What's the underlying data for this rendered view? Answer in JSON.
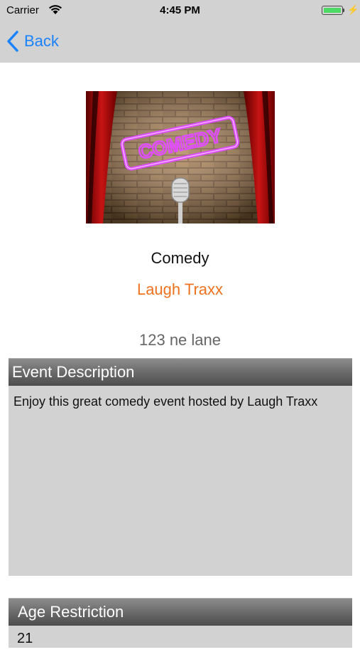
{
  "status_bar": {
    "carrier": "Carrier",
    "time": "4:45 PM",
    "battery_level": 1.0,
    "battery_color": "#4cd964",
    "icons": [
      "wifi-icon",
      "battery-icon",
      "charging-bolt-icon"
    ]
  },
  "nav": {
    "back_label": "Back",
    "accent_color": "#1a82fb"
  },
  "event": {
    "image_sign_text": "COMEDY",
    "title": "Comedy",
    "host": "Laugh Traxx",
    "host_color": "#ee7220",
    "address": "123 ne lane"
  },
  "description": {
    "header": "Event Description",
    "text": "Enjoy this great comedy event hosted by Laugh Traxx"
  },
  "age_restriction": {
    "header": "Age Restriction",
    "value": "21"
  }
}
